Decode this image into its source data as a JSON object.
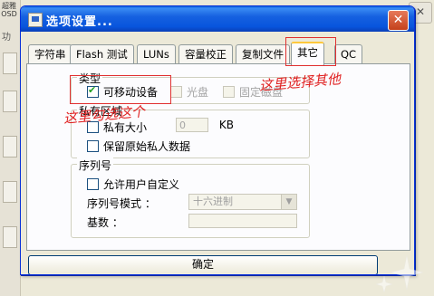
{
  "background": {
    "left_logo": "超雅\nOSD",
    "left_text": "功"
  },
  "dialog": {
    "title": "选项设置...",
    "tabs": [
      {
        "label": "字符串"
      },
      {
        "label": "Flash 测试"
      },
      {
        "label": "LUNs"
      },
      {
        "label": "容量校正"
      },
      {
        "label": "复制文件"
      },
      {
        "label": "其它",
        "active": true
      },
      {
        "label": "QC"
      }
    ],
    "type_group": {
      "label": "类型",
      "removable": {
        "label": "可移动设备",
        "checked": true
      },
      "cdrom": {
        "label": "光盘",
        "checked": false,
        "disabled": true
      },
      "fixed": {
        "label": "固定磁盘",
        "checked": false,
        "disabled": true
      }
    },
    "private_group": {
      "label": "私有区域",
      "size": {
        "label": "私有大小",
        "checked": false,
        "value": "0",
        "unit": "KB"
      },
      "keep_data": {
        "label": "保留原始私人数据",
        "checked": false
      }
    },
    "serial_group": {
      "label": "序列号",
      "allow_custom": {
        "label": "允许用户自定义",
        "checked": false
      },
      "mode_label": "序列号模式 ：",
      "mode_value": "十六进制",
      "base_label": "基数 ："
    },
    "ok_label": "确定"
  },
  "annotations": {
    "right_note": "这里选择其他",
    "left_note": "这里勾选这个"
  },
  "colors": {
    "title_bar": "#0855dd",
    "annotation_red": "#e02020",
    "tab_highlight": "#ffc83c"
  }
}
